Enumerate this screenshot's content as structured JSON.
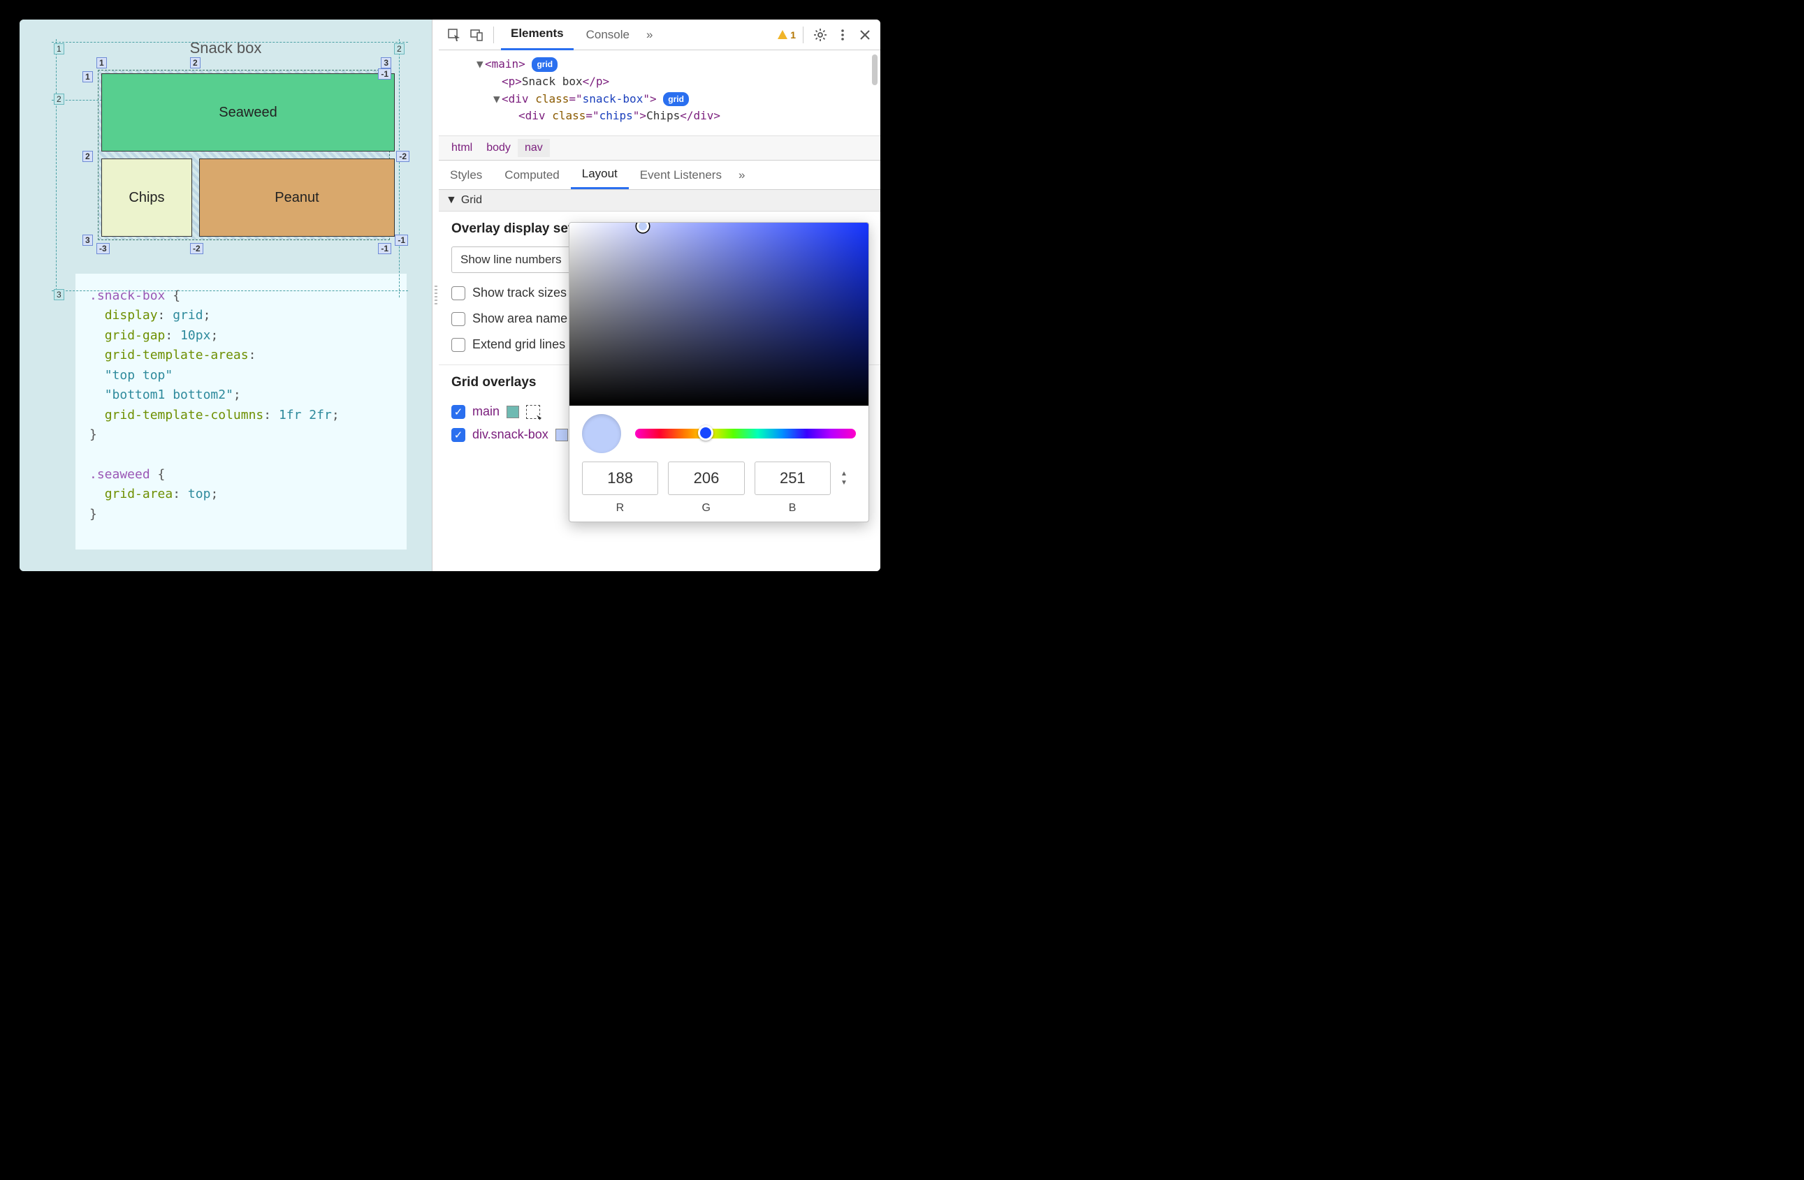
{
  "page": {
    "title": "Snack box",
    "grid": {
      "seaweed": "Seaweed",
      "chips": "Chips",
      "peanut": "Peanut"
    }
  },
  "code": {
    "sel1": ".snack-box",
    "decl1_prop": "display",
    "decl1_val": "grid",
    "decl2_prop": "grid-gap",
    "decl2_val": "10px",
    "decl3_prop": "grid-template-areas",
    "decl3_val1": "\"top top\"",
    "decl3_val2": "\"bottom1 bottom2\"",
    "decl4_prop": "grid-template-columns",
    "decl4_val": "1fr 2fr",
    "sel2": ".seaweed",
    "decl5_prop": "grid-area",
    "decl5_val": "top"
  },
  "devtools": {
    "tabs": {
      "elements": "Elements",
      "console": "Console",
      "more": "»"
    },
    "warnings": "1",
    "dom": {
      "main_open": "main",
      "grid_badge": "grid",
      "p_text": "Snack box",
      "div_tag": "div",
      "class_attr": "class",
      "snackbox_val": "snack-box",
      "chips_val": "chips",
      "chips_text": "Chips"
    },
    "breadcrumb": {
      "html": "html",
      "body": "body",
      "nav": "nav"
    },
    "subtabs": {
      "styles": "Styles",
      "computed": "Computed",
      "layout": "Layout",
      "listeners": "Event Listeners",
      "more": "»"
    },
    "grid_section": "Grid",
    "overlay_heading": "Overlay display sett",
    "dropdown": "Show line numbers",
    "opts": {
      "track": "Show track sizes",
      "area": "Show area name",
      "extend": "Extend grid lines"
    },
    "overlays_heading": "Grid overlays",
    "overlay_items": {
      "main": "main",
      "snack": "div.snack-box"
    },
    "swatch_main": "#6fbab2"
  },
  "picker": {
    "r": "188",
    "g": "206",
    "b": "251",
    "R": "R",
    "G": "G",
    "B": "B"
  }
}
